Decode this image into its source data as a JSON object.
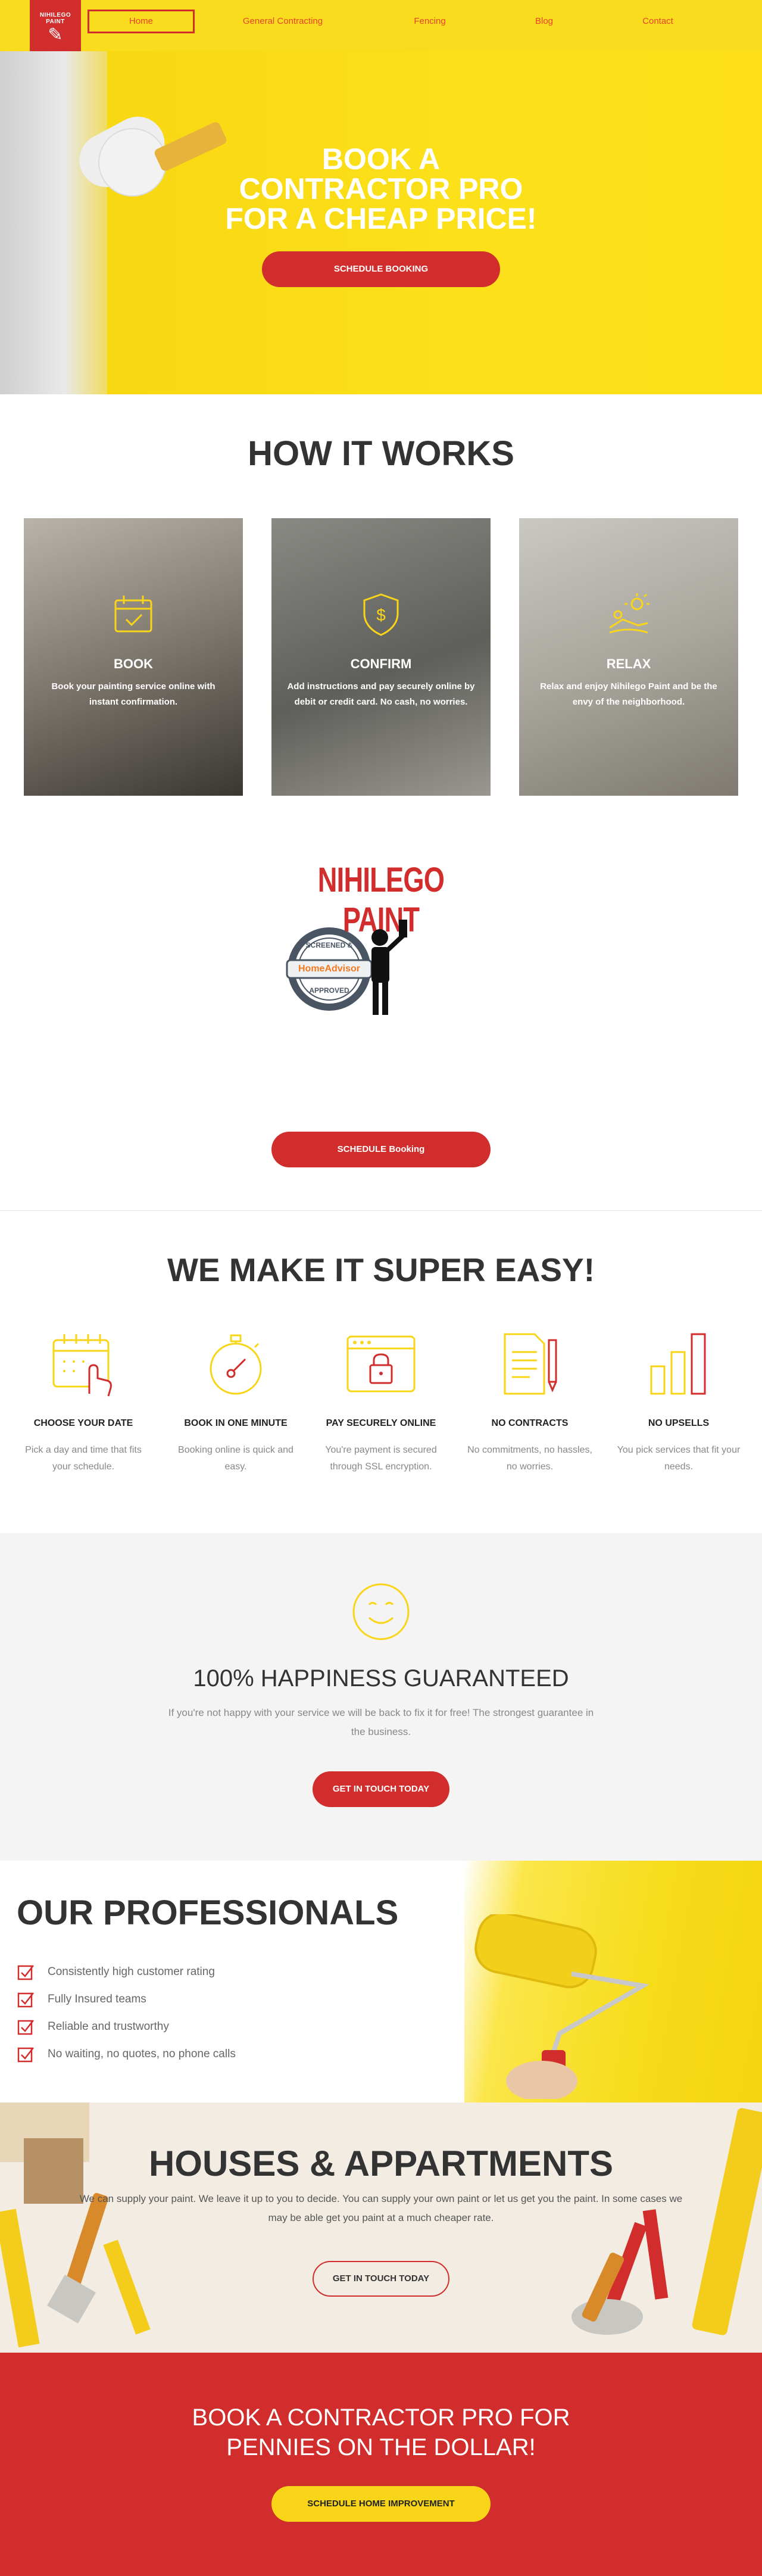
{
  "nav": {
    "logo_text": "NIHILEGO PAINT",
    "items": [
      {
        "label": "Home"
      },
      {
        "label": "General Contracting"
      },
      {
        "label": "Fencing"
      },
      {
        "label": "Blog"
      },
      {
        "label": "Contact"
      }
    ]
  },
  "hero": {
    "title_lines": [
      "BOOK A",
      "CONTRACTOR PRO",
      "FOR A CHEAP PRICE!"
    ],
    "button": "SCHEDULE BOOKING"
  },
  "how": {
    "title": "HOW IT WORKS",
    "cards": [
      {
        "icon": "calendar-check-icon",
        "title": "BOOK",
        "desc": "Book your painting service online with instant confirmation."
      },
      {
        "icon": "shield-dollar-icon",
        "title": "CONFIRM",
        "desc": "Add instructions and pay securely online by debit or credit card. No cash, no worries."
      },
      {
        "icon": "relax-sun-icon",
        "title": "RELAX",
        "desc": "Relax and enjoy Nihilego Paint and be the envy of the neighborhood."
      }
    ]
  },
  "brand": {
    "name": "NIHILEGO PAINT",
    "badge_top": "SCREENED &",
    "badge_mid": "HomeAdvisor",
    "badge_bottom": "APPROVED",
    "button": "SCHEDULE Booking"
  },
  "easy": {
    "title": "WE MAKE IT SUPER EASY!",
    "features": [
      {
        "icon": "calendar-hand-icon",
        "title": "CHOOSE YOUR DATE",
        "desc": "Pick a day and time that fits your schedule."
      },
      {
        "icon": "stopwatch-icon",
        "title": "BOOK IN ONE MINUTE",
        "desc": "Booking online is quick and easy."
      },
      {
        "icon": "browser-lock-icon",
        "title": "PAY SECURELY ONLINE",
        "desc": "You're payment is secured through SSL encryption."
      },
      {
        "icon": "contract-pen-icon",
        "title": "NO CONTRACTS",
        "desc": "No commitments, no hassles, no worries."
      },
      {
        "icon": "bar-chart-icon",
        "title": "NO UPSELLS",
        "desc": "You pick services that fit your needs."
      }
    ]
  },
  "guarantee": {
    "icon": "smiley-icon",
    "title": "100% HAPPINESS GUARANTEED",
    "desc": "If you're not happy with your service we will be back to fix it for free! The strongest guarantee in the business.",
    "button": "GET IN TOUCH TODAY"
  },
  "pros": {
    "title": "OUR PROFESSIONALS",
    "items": [
      "Consistently high customer rating",
      "Fully Insured teams",
      "Reliable and trustworthy",
      "No waiting, no quotes, no phone calls"
    ]
  },
  "houses": {
    "title": "HOUSES & APPARTMENTS",
    "desc": "We can supply your paint. We leave it up to you to decide. You can supply your own paint or let us get you the paint. In some cases we may be able get you paint at a much cheaper rate.",
    "button": "GET IN TOUCH TODAY"
  },
  "cta": {
    "title": "BOOK A CONTRACTOR PRO FOR PENNIES ON THE DOLLAR!",
    "button": "SCHEDULE HOME IMPROVEMENT"
  },
  "colors": {
    "yellow": "#f9dc1e",
    "red": "#d12d2c",
    "nav_link": "#e8432a",
    "gray_bg": "#f3f4f3"
  }
}
